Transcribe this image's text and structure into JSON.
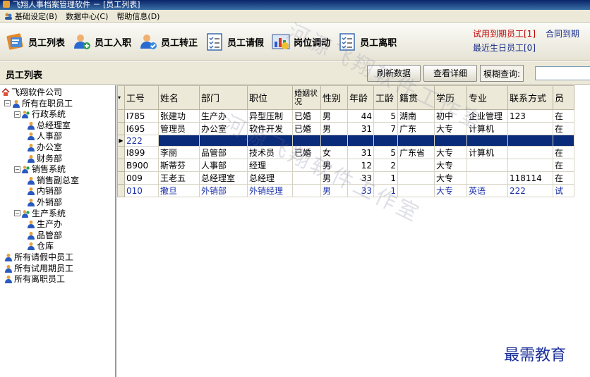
{
  "window": {
    "title": "飞翔人事档案管理软件 － [员工列表]"
  },
  "menu": [
    {
      "label": "基础设定(B)"
    },
    {
      "label": "数据中心(C)"
    },
    {
      "label": "帮助信息(D)"
    }
  ],
  "toolbar": {
    "buttons": [
      {
        "label": "员工列表",
        "icon": "employee-list-icon"
      },
      {
        "label": "员工入职",
        "icon": "employee-join-icon"
      },
      {
        "label": "员工转正",
        "icon": "employee-regularize-icon"
      },
      {
        "label": "员工请假",
        "icon": "leave-checklist-icon"
      },
      {
        "label": "岗位调动",
        "icon": "transfer-chart-icon"
      },
      {
        "label": "员工离职",
        "icon": "resign-checklist-icon"
      }
    ],
    "trial_link": "试用到期员工[1]",
    "contract_link": "合同到期",
    "birthday_link": "最近生日员工[0]"
  },
  "panel": {
    "title": "员工列表",
    "refresh_label": "刷新数据",
    "detail_label": "查看详细",
    "fuzzy_label": "模糊查询:",
    "search_value": ""
  },
  "tree": [
    {
      "label": "飞翔软件公司",
      "level": 0,
      "icon": "house-icon",
      "expander": ""
    },
    {
      "label": "所有在职员工",
      "level": 0,
      "icon": "person-icon",
      "expander": "−"
    },
    {
      "label": "行政系统",
      "level": 1,
      "icon": "group-icon",
      "expander": "−"
    },
    {
      "label": "总经理室",
      "level": 2,
      "icon": "person-icon",
      "expander": ""
    },
    {
      "label": "人事部",
      "level": 2,
      "icon": "person-icon",
      "expander": ""
    },
    {
      "label": "办公室",
      "level": 2,
      "icon": "person-icon",
      "expander": ""
    },
    {
      "label": "财务部",
      "level": 2,
      "icon": "person-icon",
      "expander": ""
    },
    {
      "label": "销售系统",
      "level": 1,
      "icon": "group-icon",
      "expander": "−"
    },
    {
      "label": "销售副总室",
      "level": 2,
      "icon": "person-icon",
      "expander": ""
    },
    {
      "label": "内销部",
      "level": 2,
      "icon": "person-icon",
      "expander": ""
    },
    {
      "label": "外销部",
      "level": 2,
      "icon": "person-icon",
      "expander": ""
    },
    {
      "label": "生产系统",
      "level": 1,
      "icon": "group-icon",
      "expander": "−"
    },
    {
      "label": "生产办",
      "level": 2,
      "icon": "person-icon",
      "expander": ""
    },
    {
      "label": "品管部",
      "level": 2,
      "icon": "person-icon",
      "expander": ""
    },
    {
      "label": "仓库",
      "level": 2,
      "icon": "person-icon",
      "expander": ""
    },
    {
      "label": "所有请假中员工",
      "level": 0,
      "icon": "person-icon",
      "expander": ""
    },
    {
      "label": "所有试用期员工",
      "level": 0,
      "icon": "person-icon",
      "expander": ""
    },
    {
      "label": "所有离职员工",
      "level": 0,
      "icon": "person-icon",
      "expander": ""
    }
  ],
  "table": {
    "columns": [
      "工号",
      "姓名",
      "部门",
      "职位",
      "婚姻状况",
      "性别",
      "年龄",
      "工龄",
      "籍贯",
      "学历",
      "专业",
      "联系方式",
      "员"
    ],
    "rows": [
      {
        "cells": [
          "I785",
          "张建功",
          "生产办",
          "异型压制",
          "已婚",
          "男",
          "44",
          "5",
          "湖南",
          "初中",
          "企业管理",
          "123",
          "在"
        ],
        "state": "normal",
        "marker": ""
      },
      {
        "cells": [
          "I695",
          "管理员",
          "办公室",
          "软件开发",
          "已婚",
          "男",
          "31",
          "7",
          "广东",
          "大专",
          "计算机",
          "",
          "在"
        ],
        "state": "normal",
        "marker": ""
      },
      {
        "cells": [
          "222",
          "",
          "",
          "",
          "",
          "",
          "",
          "",
          "",
          "",
          "",
          "",
          ""
        ],
        "state": "selected",
        "marker": "▶"
      },
      {
        "cells": [
          "I899",
          "李丽",
          "品管部",
          "技术员",
          "已婚",
          "女",
          "31",
          "5",
          "广东省",
          "大专",
          "计算机",
          "",
          "在"
        ],
        "state": "normal",
        "marker": ""
      },
      {
        "cells": [
          "B900",
          "斯蒂芬",
          "人事部",
          "经理",
          "",
          "男",
          "12",
          "2",
          "",
          "大专",
          "",
          "",
          "在"
        ],
        "state": "normal",
        "marker": ""
      },
      {
        "cells": [
          "009",
          "王老五",
          "总经理室",
          "总经理",
          "",
          "男",
          "33",
          "1",
          "",
          "大专",
          "",
          "118114",
          "在"
        ],
        "state": "normal",
        "marker": ""
      },
      {
        "cells": [
          "010",
          "撒旦",
          "外销部",
          "外销经理",
          "",
          "男",
          "33",
          "1",
          "",
          "大专",
          "英语",
          "222",
          "试"
        ],
        "state": "blue",
        "marker": ""
      }
    ]
  },
  "watermark": "河源飞翔软件工作室",
  "corner_text": "最需教育",
  "colors": {
    "selected_row": "#0a2a7a",
    "trial_row_text": "#1a2fa8",
    "trial_link": "#c00000",
    "accent_link": "#1a2f8a"
  }
}
